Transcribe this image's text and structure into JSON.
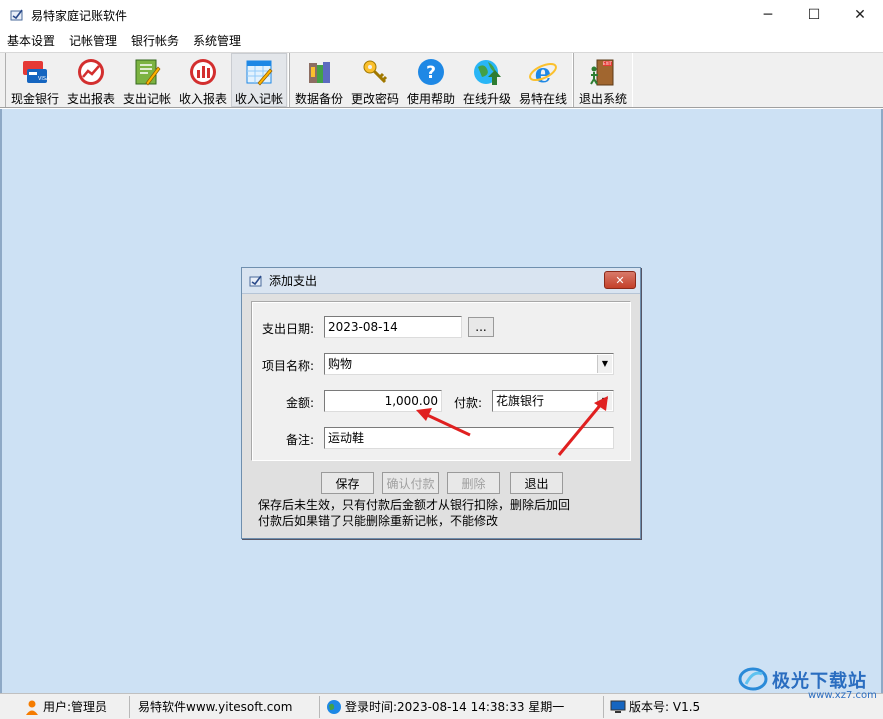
{
  "window": {
    "title": "易特家庭记账软件",
    "controls": {
      "minimize": "─",
      "maximize": "☐",
      "close": "✕"
    }
  },
  "menu": [
    "基本设置",
    "记帐管理",
    "银行帐务",
    "系统管理"
  ],
  "toolbar": {
    "group1": [
      {
        "label": "现金银行",
        "icon": "cash-bank-icon"
      },
      {
        "label": "支出报表",
        "icon": "expense-report-icon"
      },
      {
        "label": "支出记帐",
        "icon": "expense-entry-icon"
      },
      {
        "label": "收入报表",
        "icon": "income-report-icon"
      },
      {
        "label": "收入记帐",
        "icon": "income-entry-icon"
      }
    ],
    "group2": [
      {
        "label": "数据备份",
        "icon": "backup-icon"
      },
      {
        "label": "更改密码",
        "icon": "key-icon"
      },
      {
        "label": "使用帮助",
        "icon": "help-icon"
      },
      {
        "label": "在线升级",
        "icon": "globe-upgrade-icon"
      },
      {
        "label": "易特在线",
        "icon": "ie-icon"
      }
    ],
    "group3": [
      {
        "label": "退出系统",
        "icon": "exit-icon"
      }
    ]
  },
  "dialog": {
    "title": "添加支出",
    "close": "✕",
    "date_label": "支出日期:",
    "date_value": "2023-08-14",
    "date_picker": "...",
    "item_label": "项目名称:",
    "item_value": "购物",
    "amount_label": "金额:",
    "amount_value": "1,000.00",
    "pay_label": "付款:",
    "pay_value": "花旗银行",
    "memo_label": "备注:",
    "memo_value": "运动鞋",
    "buttons": {
      "save": "保存",
      "confirm": "确认付款",
      "delete": "删除",
      "exit": "退出"
    },
    "note_line1": "保存后未生效，只有付款后金额才从银行扣除，删除后加回",
    "note_line2": "付款后如果错了只能删除重新记帐，不能修改"
  },
  "status": {
    "user": "用户:管理员",
    "site": "易特软件www.yitesoft.com",
    "login": "登录时间:2023-08-14 14:38:33 星期一",
    "version": "版本号: V1.5"
  },
  "watermark": {
    "text": "极光下载站",
    "url": "www.xz7.com"
  },
  "colors": {
    "workspace": "#cde1f4",
    "arrow": "#e02020"
  }
}
